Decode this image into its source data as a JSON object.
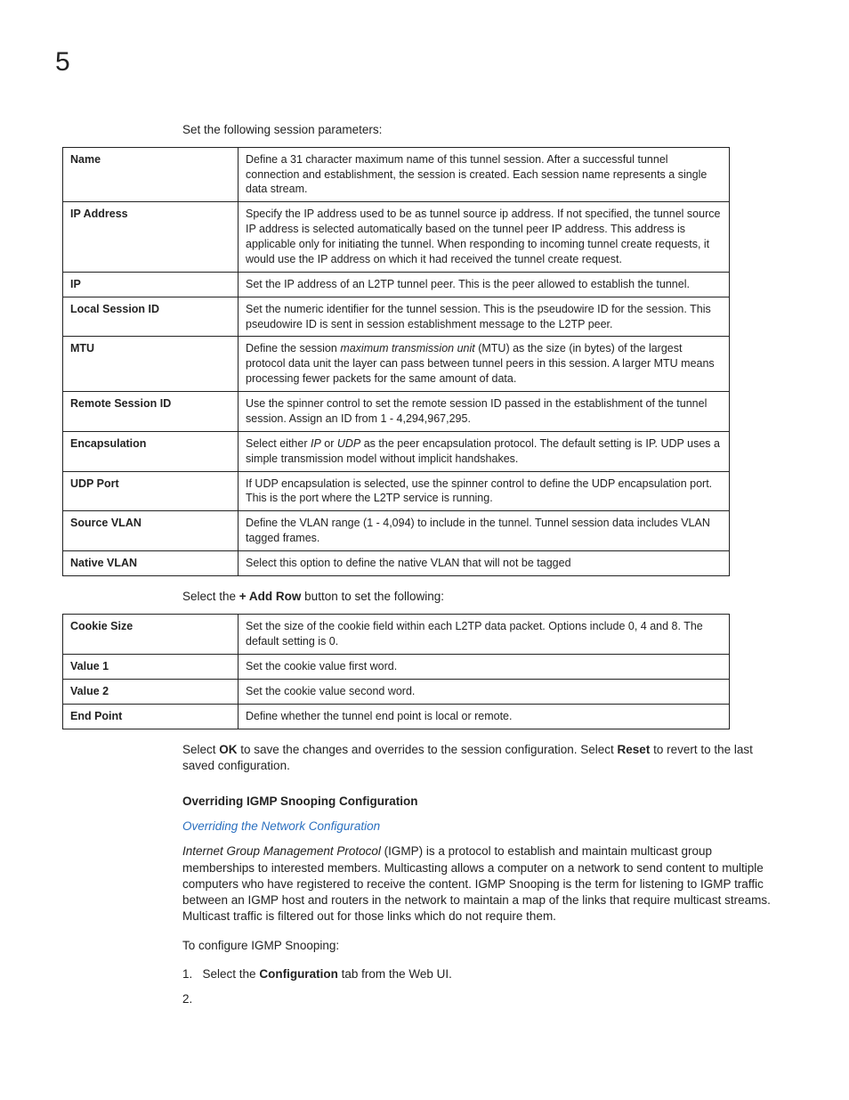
{
  "chapter": "5",
  "intro1": "Set the following session parameters:",
  "table1": {
    "rows": [
      {
        "label": "Name",
        "desc": "Define a 31 character maximum name of this tunnel session. After a successful tunnel connection and establishment, the session is created. Each session name represents a single data stream."
      },
      {
        "label": "IP Address",
        "desc": "Specify the IP address used to be as tunnel source ip address. If not specified, the tunnel source IP address is selected automatically based on the tunnel peer IP address. This address is applicable only for initiating the tunnel. When responding to incoming tunnel create requests, it would use the IP address on which it had received the tunnel create request."
      },
      {
        "label": "IP",
        "desc": "Set the IP address of an L2TP tunnel peer. This is the peer allowed to establish the tunnel."
      },
      {
        "label": "Local Session ID",
        "desc": "Set the numeric identifier for the tunnel session. This is the pseudowire ID for the session. This pseudowire ID is sent in session establishment message to the L2TP peer."
      },
      {
        "label": "MTU",
        "desc_pre": "Define the session ",
        "desc_em": "maximum transmission unit",
        "desc_post": " (MTU) as the size (in bytes) of the largest protocol data unit the layer can pass between tunnel peers in this session. A larger MTU means processing fewer packets for the same amount of data."
      },
      {
        "label": "Remote Session ID",
        "desc": "Use the spinner control to set the remote session ID passed in the establishment of the tunnel session. Assign an ID from 1 - 4,294,967,295."
      },
      {
        "label": "Encapsulation",
        "desc_pre": "Select either ",
        "desc_em_a": "IP",
        "desc_mid": " or ",
        "desc_em_b": "UDP",
        "desc_post": " as the peer encapsulation protocol. The default setting is IP. UDP uses a simple transmission model without implicit handshakes."
      },
      {
        "label": "UDP Port",
        "desc": "If UDP encapsulation is selected, use the spinner control to define the UDP encapsulation port. This is the port where the L2TP service is running."
      },
      {
        "label": "Source VLAN",
        "desc": "Define the VLAN range (1 - 4,094) to include in the tunnel. Tunnel session data includes VLAN tagged frames."
      },
      {
        "label": "Native VLAN",
        "desc": "Select this option to define the native VLAN that will not be tagged"
      }
    ]
  },
  "intro2_pre": "Select the ",
  "intro2_b": "+ Add Row",
  "intro2_post": " button to set the following:",
  "table2": {
    "rows": [
      {
        "label": "Cookie Size",
        "desc": "Set the size of the cookie field within each L2TP data packet. Options include 0, 4 and 8. The default setting is 0."
      },
      {
        "label": "Value 1",
        "desc": "Set the cookie value first word."
      },
      {
        "label": "Value 2",
        "desc": "Set the cookie value second word."
      },
      {
        "label": "End Point",
        "desc": "Define whether the tunnel end point is local or remote."
      }
    ]
  },
  "para_ok_pre": "Select ",
  "para_ok_b": "OK",
  "para_ok_mid": " to save the changes and overrides to the session configuration. Select ",
  "para_re_b": "Reset",
  "para_ok_post": " to revert to the last saved configuration.",
  "heading2": "Overriding IGMP Snooping Configuration",
  "linktext": "Overriding the Network Configuration",
  "igmp_em": "Internet Group Management Protocol",
  "igmp_rest": " (IGMP) is a protocol to establish and maintain multicast group memberships to interested members. Multicasting allows a computer on a network to send content to multiple computers who have registered to receive the content. IGMP Snooping is the term for listening to IGMP traffic between an IGMP host and routers in the network to maintain a map of the links that require multicast streams. Multicast traffic is filtered out for those links which do not require them.",
  "to_conf": "To configure IGMP Snooping:",
  "step1_num": "1.",
  "step1_pre": "Select the ",
  "step1_b": "Configuration",
  "step1_post": " tab from the Web UI.",
  "step2_num": "2."
}
